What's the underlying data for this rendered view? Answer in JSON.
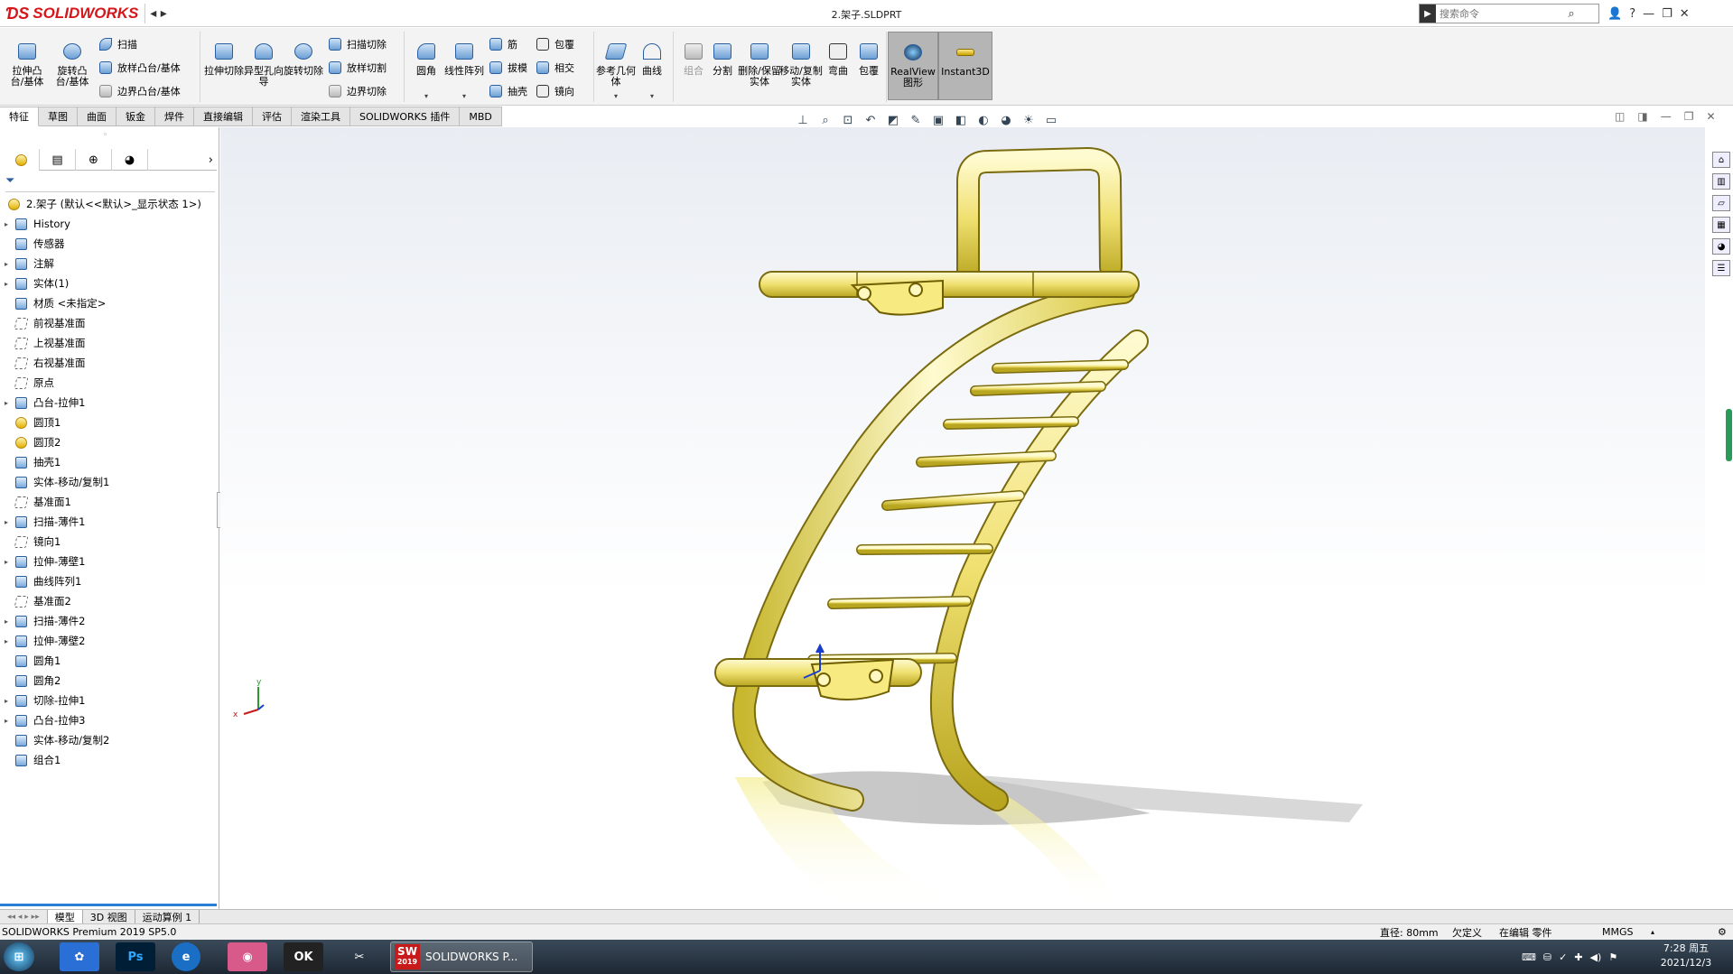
{
  "titlebar": {
    "logo_text": "SOLIDWORKS",
    "document_title": "2.架子.SLDPRT",
    "search_placeholder": "搜索命令"
  },
  "ribbon": {
    "extrude_boss": "拉伸凸台/基体",
    "revolve_boss": "旋转凸台/基体",
    "sweep": "扫描",
    "loft_boss": "放样凸台/基体",
    "boundary_boss": "边界凸台/基体",
    "extrude_cut": "拉伸切除",
    "hole_wizard": "异型孔向导",
    "revolve_cut": "旋转切除",
    "sweep_cut": "扫描切除",
    "loft_cut": "放样切割",
    "boundary_cut": "边界切除",
    "fillet": "圆角",
    "linear_pattern": "线性阵列",
    "rib": "筋",
    "draft": "拔模",
    "shell": "抽壳",
    "wrap": "包覆",
    "intersect": "相交",
    "mirror": "镜向",
    "reference_geometry": "参考几何体",
    "curves": "曲线",
    "combine": "组合",
    "split": "分割",
    "delete_keep_body": "删除/保留实体",
    "move_copy_body": "移动/复制实体",
    "flex": "弯曲",
    "wrap2": "包覆",
    "realview": "RealView图形",
    "instant3d": "Instant3D"
  },
  "tabs": [
    "特征",
    "草图",
    "曲面",
    "钣金",
    "焊件",
    "直接编辑",
    "评估",
    "渲染工具",
    "SOLIDWORKS 插件",
    "MBD"
  ],
  "tree": {
    "root": "2.架子 (默认<<默认>_显示状态 1>)",
    "items": [
      {
        "label": "History",
        "expand": true,
        "icon": "history-icon"
      },
      {
        "label": "传感器",
        "expand": false,
        "icon": "sensor-icon"
      },
      {
        "label": "注解",
        "expand": true,
        "icon": "annotation-icon"
      },
      {
        "label": "实体(1)",
        "expand": true,
        "icon": "solid-bodies-icon"
      },
      {
        "label": "材质 <未指定>",
        "expand": false,
        "icon": "material-icon"
      },
      {
        "label": "前视基准面",
        "expand": false,
        "icon": "plane-icon"
      },
      {
        "label": "上视基准面",
        "expand": false,
        "icon": "plane-icon"
      },
      {
        "label": "右视基准面",
        "expand": false,
        "icon": "plane-icon"
      },
      {
        "label": "原点",
        "expand": false,
        "icon": "origin-icon"
      },
      {
        "label": "凸台-拉伸1",
        "expand": true,
        "icon": "extrude-icon"
      },
      {
        "label": "圆顶1",
        "expand": false,
        "icon": "dome-icon"
      },
      {
        "label": "圆顶2",
        "expand": false,
        "icon": "dome-icon"
      },
      {
        "label": "抽壳1",
        "expand": false,
        "icon": "shell-icon"
      },
      {
        "label": "实体-移动/复制1",
        "expand": false,
        "icon": "move-copy-icon"
      },
      {
        "label": "基准面1",
        "expand": false,
        "icon": "plane-icon"
      },
      {
        "label": "扫描-薄件1",
        "expand": true,
        "icon": "sweep-icon"
      },
      {
        "label": "镜向1",
        "expand": false,
        "icon": "mirror-icon"
      },
      {
        "label": "拉伸-薄壁1",
        "expand": true,
        "icon": "extrude-icon"
      },
      {
        "label": "曲线阵列1",
        "expand": false,
        "icon": "curve-pattern-icon"
      },
      {
        "label": "基准面2",
        "expand": false,
        "icon": "plane-icon"
      },
      {
        "label": "扫描-薄件2",
        "expand": true,
        "icon": "sweep-icon"
      },
      {
        "label": "拉伸-薄壁2",
        "expand": true,
        "icon": "extrude-icon"
      },
      {
        "label": "圆角1",
        "expand": false,
        "icon": "fillet-icon"
      },
      {
        "label": "圆角2",
        "expand": false,
        "icon": "fillet-icon"
      },
      {
        "label": "切除-拉伸1",
        "expand": true,
        "icon": "cut-extrude-icon"
      },
      {
        "label": "凸台-拉伸3",
        "expand": true,
        "icon": "extrude-icon"
      },
      {
        "label": "实体-移动/复制2",
        "expand": false,
        "icon": "move-copy-icon"
      },
      {
        "label": "组合1",
        "expand": false,
        "icon": "combine-icon"
      }
    ]
  },
  "bottom_tabs": [
    "模型",
    "3D 视图",
    "运动算例 1"
  ],
  "status": {
    "product": "SOLIDWORKS Premium 2019 SP5.0",
    "radius": "直径: 80mm",
    "defined": "欠定义",
    "editing": "在编辑 零件",
    "units": "MMGS"
  },
  "taskbar": {
    "sw_label": "SOLIDWORKS P...",
    "sw_version": "2019",
    "time": "7:28 周五",
    "date": "2021/12/3"
  },
  "colors": {
    "accent": "#d6161a",
    "model": "#f5ec9a",
    "model_edge": "#8a7a10",
    "tree_selection": "#2a7fd4"
  }
}
